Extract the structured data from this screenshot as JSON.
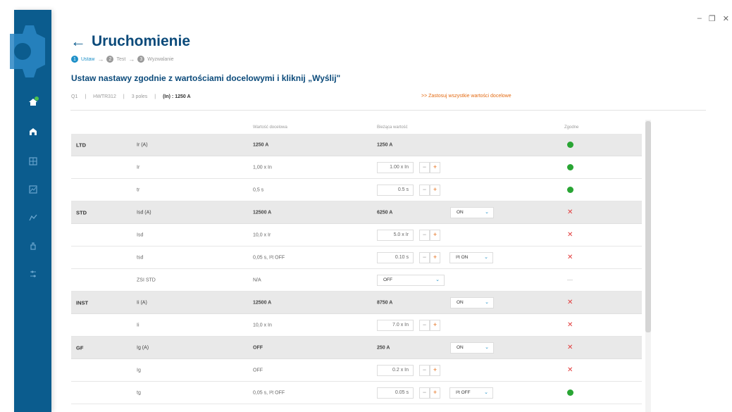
{
  "window": {
    "minimize": "–",
    "restore": "❐",
    "close": "✕"
  },
  "sidebar": {
    "items": [
      {
        "icon": "home-icon"
      },
      {
        "icon": "building-icon"
      },
      {
        "icon": "grid-icon"
      },
      {
        "icon": "chart-icon"
      },
      {
        "icon": "trend-icon"
      },
      {
        "icon": "hand-icon"
      },
      {
        "icon": "sliders-icon"
      }
    ]
  },
  "header": {
    "back": "←",
    "title": "Uruchomienie",
    "steps": [
      {
        "num": "1",
        "label": "Ustaw"
      },
      {
        "num": "2",
        "label": "Test"
      },
      {
        "num": "3",
        "label": "Wyzwalanie"
      }
    ],
    "step_sep": "→",
    "instruction": "Ustaw nastawy zgodnie z wartościami docelowymi i kliknij „Wyślij\"",
    "meta": {
      "q": "Q1",
      "model": "HWTR312",
      "poles": "3 poles",
      "in_label": "(In) : 1250 A",
      "sep": "|"
    },
    "apply_all": ">> Zastosuj wszystkie wartości docelowe"
  },
  "table": {
    "columns": {
      "target": "Wartość docelowa",
      "current": "Bieżąca wartość",
      "match": "Zgodne"
    },
    "rows": [
      {
        "group": "LTD",
        "param": "Ir (A)",
        "target": "1250 A",
        "current": "1250 A",
        "status": "ok"
      },
      {
        "param": "Ir",
        "target": "1,00 x In",
        "input": "1.00 x In",
        "status": "ok"
      },
      {
        "param": "tr",
        "target": "0,5 s",
        "input": "0.5 s",
        "status": "ok"
      },
      {
        "group": "STD",
        "param": "Isd (A)",
        "target": "12500 A",
        "current": "6250 A",
        "select": "ON",
        "status": "err"
      },
      {
        "param": "Isd",
        "target": "10,0 x Ir",
        "input": "5.0 x Ir",
        "status": "err"
      },
      {
        "param": "tsd",
        "target": "0,05 s, I²t OFF",
        "input": "0.10 s",
        "select": "I²t ON",
        "status": "err"
      },
      {
        "param": "ZSI STD",
        "target": "N/A",
        "dropdown": "OFF",
        "status": "none"
      },
      {
        "group": "INST",
        "param": "Ii (A)",
        "target": "12500 A",
        "current": "8750 A",
        "select": "ON",
        "status": "err"
      },
      {
        "param": "Ii",
        "target": "10,0 x In",
        "input": "7.0 x In",
        "status": "err"
      },
      {
        "group": "GF",
        "param": "Ig (A)",
        "target": "OFF",
        "current": "250 A",
        "select": "ON",
        "status": "err"
      },
      {
        "param": "Ig",
        "target": "OFF",
        "input": "0.2 x In",
        "status": "err"
      },
      {
        "param": "tg",
        "target": "0,05 s, I²t OFF",
        "input": "0.05 s",
        "select": "I²t OFF",
        "status": "ok"
      }
    ],
    "labels": {
      "minus": "−",
      "plus": "+",
      "chev": "⌄",
      "err": "✕",
      "dash": "—"
    }
  },
  "colors": {
    "sidebar": "#0b5c8e",
    "title": "#0b4a7a",
    "accent": "#1e90c8",
    "orange": "#e36a12",
    "ok": "#29a534",
    "error": "#e23b3b"
  }
}
